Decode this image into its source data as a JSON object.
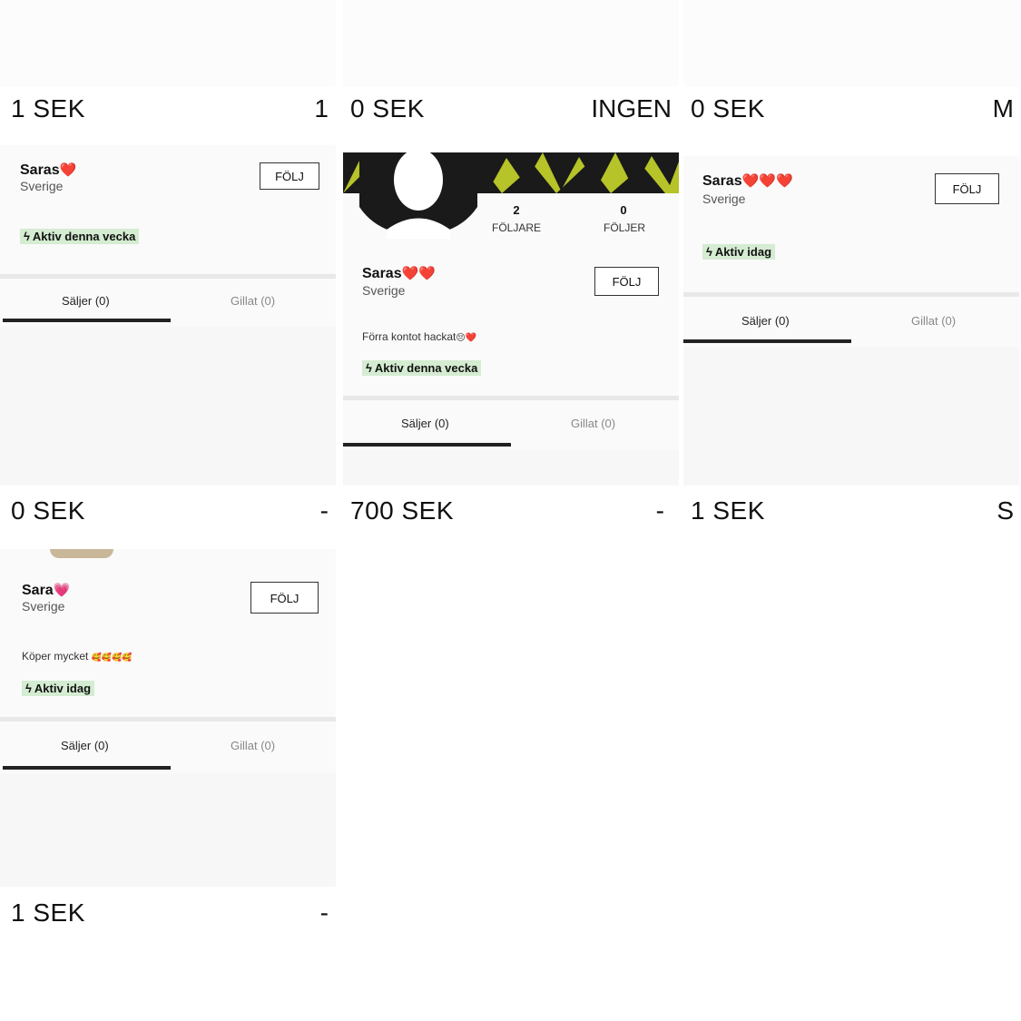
{
  "listings": [
    {
      "price": "1 SEK",
      "size": "1"
    },
    {
      "price": "0 SEK",
      "size": "INGEN"
    },
    {
      "price": "0 SEK",
      "size": "M"
    },
    {
      "price": "0 SEK",
      "size": "-"
    },
    {
      "price": "700 SEK",
      "size": "-"
    },
    {
      "price": "1 SEK",
      "size": "S"
    },
    {
      "price": "1 SEK",
      "size": "-"
    }
  ],
  "profiles": [
    {
      "name": "Saras",
      "hearts": "❤️",
      "location": "Sverige",
      "follow": "FÖLJ",
      "activity": "Aktiv denna vecka",
      "tab_sell": "Säljer (0)",
      "tab_liked": "Gillat (0)"
    },
    {
      "name": "Saras",
      "hearts": "❤️❤️",
      "location": "Sverige",
      "follow": "FÖLJ",
      "bio": "Förra kontot hackat",
      "bio_emoji": "😔❤️",
      "activity": "Aktiv denna vecka",
      "tab_sell": "Säljer (0)",
      "tab_liked": "Gillat (0)",
      "followers_count": "2",
      "followers_label": "FÖLJARE",
      "following_count": "0",
      "following_label": "FÖLJER"
    },
    {
      "name": "Saras",
      "hearts": "❤️❤️❤️",
      "location": "Sverige",
      "follow": "FÖLJ",
      "activity": "Aktiv idag",
      "tab_sell": "Säljer (0)",
      "tab_liked": "Gillat (0)"
    },
    {
      "name": "Sara",
      "hearts": "💗",
      "location": "Sverige",
      "follow": "FÖLJ",
      "bio": "Köper mycket",
      "bio_emoji": "🥰🥰🥰🥰",
      "activity": "Aktiv idag",
      "tab_sell": "Säljer (0)",
      "tab_liked": "Gillat (0)"
    }
  ],
  "icons": {
    "activity": "lightning-bolt-icon",
    "avatar": "silhouette-avatar"
  },
  "colors": {
    "activity_badge": "#d4ecd1",
    "heart": "#e3262a",
    "banner_green": "#c8d62b"
  }
}
